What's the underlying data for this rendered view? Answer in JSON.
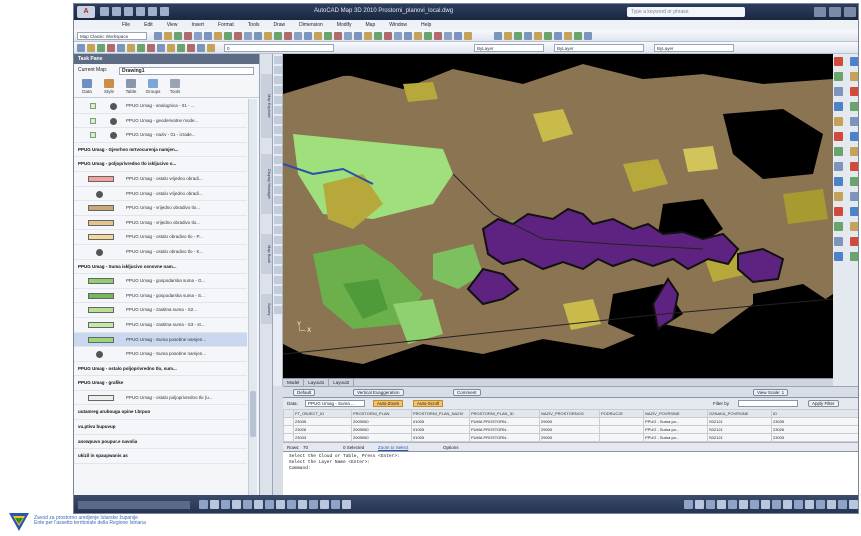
{
  "window": {
    "title": "AutoCAD Map 3D 2010   Prostorni_planovi_local.dwg",
    "search_placeholder": "Type a keyword or phrase"
  },
  "menubar": [
    "File",
    "Edit",
    "View",
    "Insert",
    "Format",
    "Tools",
    "Draw",
    "Dimension",
    "Modify",
    "Map",
    "Window",
    "Help"
  ],
  "toolbar": {
    "workspace": "Map Classic Workspace",
    "layer": "0",
    "layer_combo": "ByLayer",
    "linetype_combo": "ByLayer",
    "lineweight_combo": "ByLayer"
  },
  "task_pane": {
    "title": "Task Pane",
    "current_map_label": "Current Map:",
    "current_map_value": "Drawing1",
    "tabs": [
      "Data",
      "Style",
      "Table",
      "Groups",
      "Tools"
    ],
    "rows": [
      {
        "kind": "chk",
        "label": "PPUG Umag - analognica - 01 - ..."
      },
      {
        "kind": "chk",
        "label": "PPUG Umag - geoderivatne mode..."
      },
      {
        "kind": "chk",
        "label": "PPUG Umag - naziv - 01 - izrade..."
      },
      {
        "kind": "grp",
        "label": "PPUG Umag - Gjevrhvo mrtvocurenja namjen..."
      },
      {
        "kind": "grp",
        "label": "PPUG Umag - poljoprivredno tlo iskljucivo o..."
      },
      {
        "kind": "sw",
        "color": "#f2a39d",
        "label": "PPUG Umag - ostalo vrijedno obradi..."
      },
      {
        "kind": "sym",
        "label": "PPUG Umag - ostalo vrijedno obradi..."
      },
      {
        "kind": "sw",
        "color": "#c9a779",
        "label": "PPUG Umag - vrijedno obradivo tlo..."
      },
      {
        "kind": "sw",
        "color": "#e7c48e",
        "label": "PPUG Umag - vrijedno obradivo tlo..."
      },
      {
        "kind": "sw",
        "color": "#f6d89a",
        "label": "PPUG Umag - ostalo obradivo tlo - P..."
      },
      {
        "kind": "sym",
        "label": "PPUG Umag - ostalo obradivo tlo - K..."
      },
      {
        "kind": "grp",
        "label": "PPUG Umag - Suma iskljucivo osnovne nam..."
      },
      {
        "kind": "sw",
        "color": "#8fcf74",
        "label": "PPUG Umag - gospodarska suma - G..."
      },
      {
        "kind": "sw",
        "color": "#73b85a",
        "label": "PPUG Umag - gospodarska suma - S..."
      },
      {
        "kind": "sw",
        "color": "#b8df92",
        "label": "PPUG Umag - zastitna suma - S2..."
      },
      {
        "kind": "sw",
        "color": "#c7e8a6",
        "label": "PPUG Umag - zastitna suma - S3 - st..."
      },
      {
        "kind": "sel",
        "color": "#9bd67d",
        "label": "PPUG Umag - Suma posebne namjen..."
      },
      {
        "kind": "sym",
        "label": "PPUG Umag - Suma posebne namjen..."
      },
      {
        "kind": "grp",
        "label": "PPUG Umag - ostalo poljoprivredno tlo, sum..."
      },
      {
        "kind": "grp",
        "label": "PPUG Umag - grafike"
      },
      {
        "kind": "sw",
        "color": "#eeeeee",
        "label": "PPUG Umag - ostalo poljoprivredno tlo (u..."
      },
      {
        "kind": "txt",
        "label": "uutamreg arubouga opine t.brpuo"
      },
      {
        "kind": "txt",
        "label": "vu.ptivu bupuvup"
      },
      {
        "kind": "txt",
        "label": "anowpuvo poupur.e navolia"
      },
      {
        "kind": "txt",
        "label": "ukizil in spaupwanis as"
      }
    ]
  },
  "side_tabs": [
    "Map Explorer",
    "Display Manager",
    "Map Book",
    "Survey"
  ],
  "map_tabs": [
    "Model",
    "Layout1",
    "Layout2"
  ],
  "status_strip": {
    "pill1": "Default",
    "pill2": "Vertical Exaggeration",
    "pill3": "Comment",
    "pill4": "View Scale: 1"
  },
  "data_table": {
    "source_label": "Data:",
    "source_value": "PPUG Umag - Suma ...",
    "btn_zoom": "Auto-Zoom",
    "btn_scroll": "Auto-Scroll",
    "filter_label": "Filter by",
    "apply_filter": "Apply Filter",
    "columns": [
      "",
      "FT_OBJECT_ID",
      "PROSTORNI_PLAN",
      "PROSTORNI_PLAN_NAZIV",
      "PROSTORNI_PLAN_ID",
      "NAZIV_PROSTORNOG",
      "PODRUCJE",
      "NAZIV_POVRSINE",
      "OZNAKA_POVRSINE",
      "ID"
    ],
    "rows": [
      [
        "",
        "23035",
        "2009050",
        "01005",
        "PUMA PROSTORN...",
        "29000",
        "",
        "PPUG - Suma po...",
        "S02121",
        "23035"
      ],
      [
        "",
        "23026",
        "2009050",
        "01005",
        "PUMA PROSTORN...",
        "29000",
        "",
        "PPUG - Suma po...",
        "S02121",
        "23026"
      ],
      [
        "",
        "23033",
        "2009050",
        "01005",
        "PUMA PROSTORN...",
        "29000",
        "",
        "PPUG - Suma po...",
        "S02121",
        "23033"
      ],
      [
        "▶",
        "24704",
        "2009050",
        "01005",
        "PUMA PROSTORN...",
        "29000",
        "",
        "PPUG - Suma po...",
        "S02121",
        "24704"
      ]
    ],
    "footer_rows_label": "Rows:",
    "footer_rows_value": "70",
    "footer_selected": "0 Selected",
    "footer_zoom_to": "Zoom to Select",
    "footer_options": "Options"
  },
  "command_line": [
    "Select the Cloud or Table, Press <Enter>:",
    "Select the Layer Name <Enter>:",
    "Command:"
  ],
  "org": {
    "line1": "Zavod za prostorno uredjenje Istarske županije",
    "line2": "Ente per l'assetto territoriale della Regione Istriana"
  },
  "colors": {
    "purple_zone": "#5e2380",
    "brown_zone": "#8b7452",
    "olive_zone": "#b6a83a",
    "green_zone": "#6cb04c",
    "light_green_zone": "#9fe07d"
  }
}
